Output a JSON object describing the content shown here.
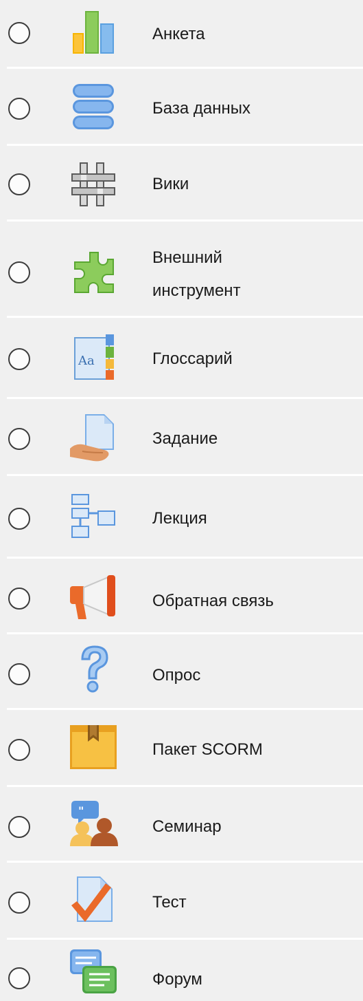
{
  "activities": [
    {
      "label": "Анкета",
      "icon": "survey-bar-chart-icon",
      "color": "#5aa0e0"
    },
    {
      "label": "База данных",
      "icon": "database-icon",
      "color": "#6ea4e8"
    },
    {
      "label": "Вики",
      "icon": "wiki-icon",
      "color": "#6a6a6a"
    },
    {
      "label": "Внешний",
      "label2": "инструмент",
      "icon": "puzzle-icon",
      "color": "#6cb33e"
    },
    {
      "label": "Глоссарий",
      "icon": "glossary-icon",
      "color": "#d7e6f7"
    },
    {
      "label": "Задание",
      "icon": "assignment-icon",
      "color": "#e8a87a"
    },
    {
      "label": "Лекция",
      "icon": "lesson-icon",
      "color": "#7ab3ea"
    },
    {
      "label": "Обратная связь",
      "icon": "megaphone-icon",
      "color": "#ea6a2a"
    },
    {
      "label": "Опрос",
      "icon": "question-icon",
      "color": "#7aaee8"
    },
    {
      "label": "Пакет SCORM",
      "icon": "package-icon",
      "color": "#f5b93b"
    },
    {
      "label": "Семинар",
      "icon": "workshop-icon",
      "color": "#e0a050"
    },
    {
      "label": "Тест",
      "icon": "quiz-checkmark-icon",
      "color": "#ea6a2a"
    },
    {
      "label": "Форум",
      "icon": "forum-icon",
      "color": "#5cb85c"
    }
  ]
}
